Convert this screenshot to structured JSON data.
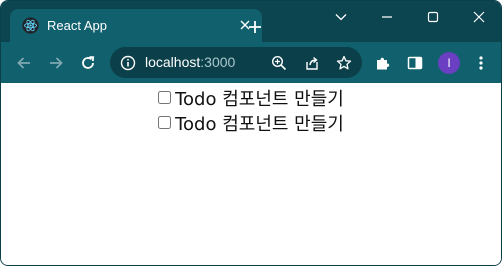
{
  "browser": {
    "tab": {
      "title": "React App",
      "icon": "react-logo-icon"
    },
    "address": {
      "host": "localhost",
      "port": ":3000"
    },
    "colors": {
      "frame": "#0c4450",
      "toolbar": "#10606e",
      "omnibox": "#0b3f49",
      "avatar": "#6a3fc1"
    },
    "profile_initial": "I"
  },
  "page": {
    "todos": [
      {
        "label": "Todo 컴포넌트 만들기",
        "checked": false
      },
      {
        "label": "Todo 컴포넌트 만들기",
        "checked": false
      }
    ]
  }
}
